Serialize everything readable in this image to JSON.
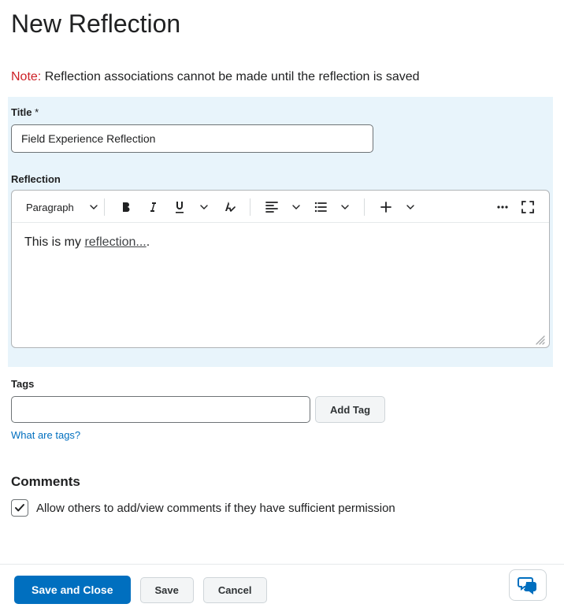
{
  "page_title": "New Reflection",
  "note": {
    "label": "Note:",
    "text": "Reflection associations cannot be made until the reflection is saved"
  },
  "title_field": {
    "label": "Title",
    "required_mark": "*",
    "value": "Field Experience Reflection"
  },
  "reflection_field": {
    "label": "Reflection",
    "toolbar": {
      "paragraph_label": "Paragraph"
    },
    "body_plain": "This is my ",
    "body_linked": "reflection...",
    "body_trail": "."
  },
  "tags": {
    "label": "Tags",
    "value": "",
    "add_button": "Add Tag",
    "help_link": "What are tags?"
  },
  "comments": {
    "heading": "Comments",
    "allow_checked": true,
    "allow_label": "Allow others to add/view comments if they have sufficient permission"
  },
  "footer": {
    "save_close": "Save and Close",
    "save": "Save",
    "cancel": "Cancel"
  }
}
